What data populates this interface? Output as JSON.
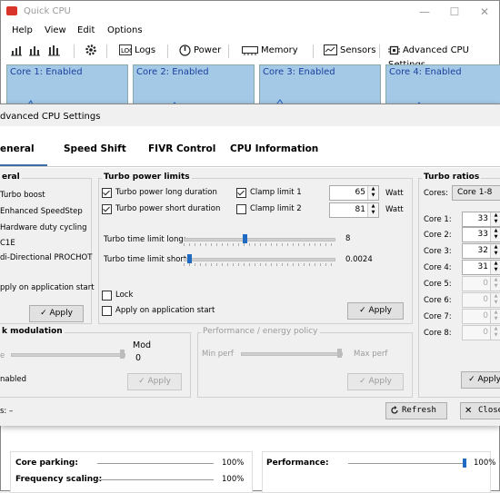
{
  "window": {
    "title": "Quick CPU",
    "controls": [
      "—",
      "☐",
      "✕"
    ]
  },
  "menu": [
    "Help",
    "View",
    "Edit",
    "Options"
  ],
  "toolbar": {
    "logs": "Logs",
    "power": "Power",
    "memory": "Memory",
    "sensors": "Sensors",
    "advanced": "Advanced CPU Settings"
  },
  "cores": [
    {
      "label": "Core 1: Enabled"
    },
    {
      "label": "Core 2: Enabled"
    },
    {
      "label": "Core 3: Enabled"
    },
    {
      "label": "Core 4: Enabled"
    }
  ],
  "bottom": {
    "core_parking": {
      "label": "Core parking:",
      "value": "100%"
    },
    "frequency_scaling": {
      "label": "Frequency scaling:",
      "value": "100%"
    },
    "performance": {
      "label": "Performance:",
      "value": "100%"
    }
  },
  "dialog": {
    "title": "dvanced CPU Settings",
    "tabs": [
      "eneral",
      "Speed Shift",
      "FIVR Control",
      "CPU Information"
    ],
    "general": {
      "title": "eral",
      "items": [
        "Turbo boost",
        "Enhanced SpeedStep",
        "Hardware duty cycling",
        "C1E",
        "di-Directional PROCHOT"
      ],
      "apply_start": "pply on application start",
      "apply": "Apply"
    },
    "turbo_limits": {
      "title": "Turbo power limits",
      "long_duration": "Turbo power long duration",
      "short_duration": "Turbo power short duration",
      "clamp1": "Clamp limit 1",
      "clamp2": "Clamp limit 2",
      "val1": "65",
      "val2": "81",
      "unit": "Watt",
      "time_long_label": "Turbo time limit long:",
      "time_long_value": "8",
      "time_short_label": "Turbo time limit short:",
      "time_short_value": "0.0024",
      "lock": "Lock",
      "apply_start": "Apply on application start",
      "apply": "Apply"
    },
    "clock_mod": {
      "title": "k modulation",
      "mod_label": "Mod",
      "mod_value": "0",
      "left_e": "e",
      "enabled": "nabled",
      "apply": "Apply"
    },
    "perf_policy": {
      "title": "Performance / energy policy",
      "min": "Min perf",
      "max": "Max perf",
      "apply": "Apply"
    },
    "turbo_ratios": {
      "title": "Turbo ratios",
      "cores_label": "Cores:",
      "cores_value": "Core 1-8",
      "rows": [
        {
          "label": "Core 1:",
          "value": "33"
        },
        {
          "label": "Core 2:",
          "value": "33"
        },
        {
          "label": "Core 3:",
          "value": "32"
        },
        {
          "label": "Core 4:",
          "value": "31"
        },
        {
          "label": "Core 5:",
          "value": "0"
        },
        {
          "label": "Core 6:",
          "value": "0"
        },
        {
          "label": "Core 7:",
          "value": "0"
        },
        {
          "label": "Core 8:",
          "value": "0"
        }
      ],
      "apply": "Apply"
    },
    "status": "s: –",
    "refresh": "Refresh",
    "close": "Close"
  }
}
